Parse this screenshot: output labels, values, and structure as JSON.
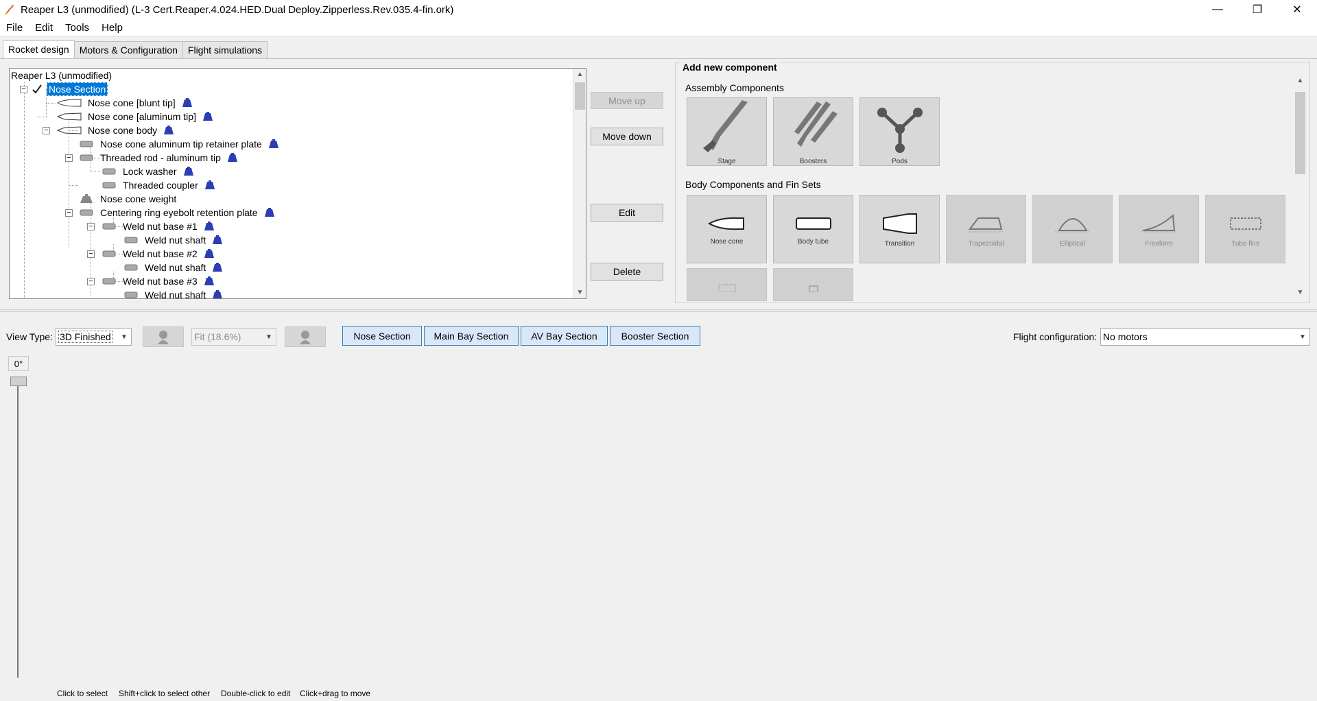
{
  "window": {
    "title": "Reaper L3 (unmodified) (L-3 Cert.Reaper.4.024.HED.Dual Deploy.Zipperless.Rev.035.4-fin.ork)",
    "minimize": "—",
    "restore": "❐",
    "close": "✕"
  },
  "menu": [
    "File",
    "Edit",
    "Tools",
    "Help"
  ],
  "tabs": [
    "Rocket design",
    "Motors & Configuration",
    "Flight simulations"
  ],
  "tree": {
    "root": "Reaper L3 (unmodified)",
    "items": [
      {
        "label": "Nose Section",
        "selected": true
      },
      {
        "label": "Nose cone [blunt tip]"
      },
      {
        "label": "Nose cone [aluminum tip]"
      },
      {
        "label": "Nose cone body"
      },
      {
        "label": "Nose cone aluminum tip retainer plate"
      },
      {
        "label": "Threaded rod - aluminum tip"
      },
      {
        "label": "Lock washer"
      },
      {
        "label": "Threaded coupler"
      },
      {
        "label": "Nose cone weight"
      },
      {
        "label": "Centering ring eyebolt retention plate"
      },
      {
        "label": "Weld nut base #1"
      },
      {
        "label": "Weld nut shaft"
      },
      {
        "label": "Weld nut base #2"
      },
      {
        "label": "Weld nut shaft"
      },
      {
        "label": "Weld nut base #3"
      },
      {
        "label": "Weld nut shaft"
      }
    ]
  },
  "side_buttons": {
    "move_up": "Move up",
    "move_down": "Move down",
    "edit": "Edit",
    "delete": "Delete"
  },
  "add_component": {
    "title": "Add new component",
    "assembly_label": "Assembly Components",
    "assembly": [
      "Stage",
      "Boosters",
      "Pods"
    ],
    "body_label": "Body Components and Fin Sets",
    "body": [
      "Nose cone",
      "Body tube",
      "Transition",
      "Trapezoidal",
      "Elliptical",
      "Freeform",
      "Tube fins"
    ]
  },
  "view": {
    "view_type_label": "View Type:",
    "view_type": "3D Finished",
    "zoom": "Fit (18.6%)",
    "stages": [
      "Nose Section",
      "Main Bay Section",
      "AV Bay Section",
      "Booster Section"
    ],
    "flight_config_label": "Flight configuration:",
    "flight_config": "No motors",
    "angle": "0°"
  },
  "hints": [
    "Click to select",
    "Shift+click to select other",
    "Double-click to edit",
    "Click+drag to move"
  ]
}
